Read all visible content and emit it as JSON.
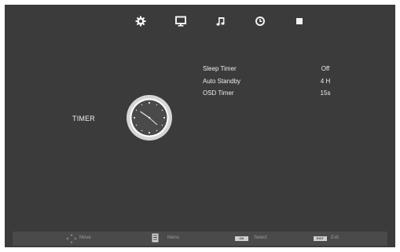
{
  "top_menu": [
    {
      "icon": "gear-icon",
      "name": "setup"
    },
    {
      "icon": "monitor-icon",
      "name": "picture"
    },
    {
      "icon": "music-note-icon",
      "name": "sound"
    },
    {
      "icon": "clock-icon",
      "name": "time"
    },
    {
      "icon": "square-icon",
      "name": "lock"
    }
  ],
  "active_section": {
    "title": "TIMER",
    "icon": "analog-clock-icon"
  },
  "menu_items": [
    {
      "label": "Sleep Timer",
      "value": "Off"
    },
    {
      "label": "Auto Standby",
      "value": "4 H"
    },
    {
      "label": "OSD Timer",
      "value": "15s"
    }
  ],
  "hints": [
    {
      "icon": "dpad-icon",
      "label": "Move"
    },
    {
      "icon": "menu-icon",
      "label": "Menu"
    },
    {
      "icon": "ok-key-icon",
      "key": "OK",
      "label": "Select"
    },
    {
      "icon": "exit-key-icon",
      "key": "EXIT",
      "label": "Exit"
    }
  ],
  "colors": {
    "background": "#3b3b3b",
    "hint_bar": "#4a4a4a",
    "text": "#ececec",
    "hint_text": "#9a9a9a"
  }
}
